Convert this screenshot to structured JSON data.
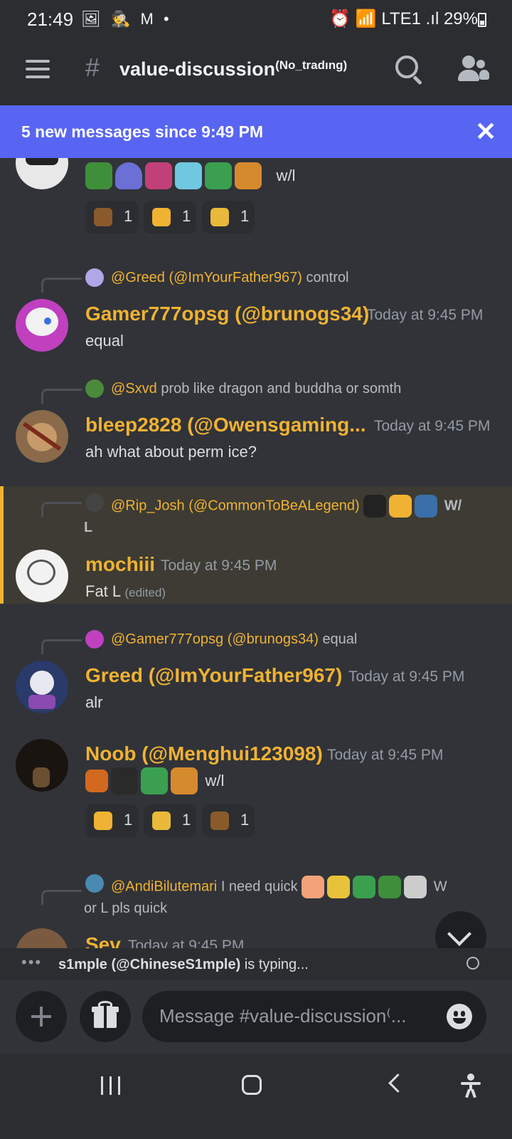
{
  "status_bar": {
    "time": "21:49",
    "left_icons": "🖼 🕵 M •",
    "right_text": "⏰ 📶 LTE1 .ıl 29%"
  },
  "header": {
    "channel_icon": "hash-lock-icon",
    "channel_name": "value-discussion",
    "channel_suffix": "(No_tradıng)"
  },
  "banner": {
    "text": "5 new messages since 9:49 PM",
    "close_icon": "close-icon"
  },
  "messages": [
    {
      "emoji_names": [
        "dragon-emoji",
        "blue-shell-emoji",
        "pink-creature-emoji",
        "tornado-emoji",
        "offer-want-emoji",
        "tiger-emoji"
      ],
      "emoji_colors": [
        "#3f8f3a",
        "#6b6fd6",
        "#c2407a",
        "#6fc8e0",
        "#3aa050",
        "#d68a2e"
      ],
      "text": "w/l",
      "reactions": [
        {
          "icon": "poop-icon",
          "color": "#8a5a2b",
          "count": "1"
        },
        {
          "icon": "trophy-icon",
          "color": "#f0b232",
          "count": "1"
        },
        {
          "icon": "equal-handshake-icon",
          "color": "#e8b93a",
          "count": "1"
        }
      ]
    },
    {
      "reply": {
        "name": "@Greed (@ImYourFather967)",
        "text": "control"
      },
      "username": "Gamer777opsg (@brunogs34)",
      "timestamp": "Today at 9:45 PM",
      "text": "equal"
    },
    {
      "reply": {
        "name": "@Sxvd",
        "text": "prob like dragon and buddha or somth"
      },
      "username": "bleep2828 (@Owensgaming...",
      "timestamp": "Today at 9:45 PM",
      "text": "ah what about perm ice?"
    },
    {
      "reply": {
        "name": "@Rip_Josh (@CommonToBeALegend)",
        "text_after_emoji": "W/",
        "text_line2": "L",
        "emoji_names": [
          "dark-figure-emoji",
          "pointing-hand-emoji",
          "portal-emoji"
        ],
        "emoji_colors": [
          "#222222",
          "#f0b232",
          "#3b6fa8"
        ]
      },
      "username": "mochiii",
      "timestamp": "Today at 9:45 PM",
      "text": "Fat L",
      "edited": "(edited)"
    },
    {
      "reply": {
        "name": "@Gamer777opsg (@brunogs34)",
        "text": "equal"
      },
      "username": "Greed (@ImYourFather967)",
      "timestamp": "Today at 9:45 PM",
      "text": "alr"
    },
    {
      "username": "Noob (@Menghui123098)",
      "timestamp": "Today at 9:45 PM",
      "emoji_names": [
        "fruit-emoji",
        "dark-figure-emoji",
        "offer-want-emoji",
        "tiger-emoji"
      ],
      "emoji_colors": [
        "#d2691e",
        "#2a2a2a",
        "#3aa050",
        "#d68a2e"
      ],
      "text": "w/l",
      "reactions": [
        {
          "icon": "trophy-icon",
          "color": "#f0b232",
          "count": "1"
        },
        {
          "icon": "equal-handshake-icon",
          "color": "#e8b93a",
          "count": "1"
        },
        {
          "icon": "poop-icon",
          "color": "#8a5a2b",
          "count": "1"
        }
      ]
    },
    {
      "reply": {
        "name": "@AndiBilutemari",
        "text": "I need quick",
        "text_after_emoji": "W",
        "text_line2": "or L pls quick",
        "emoji_names": [
          "comet-emoji",
          "buddha-emoji",
          "offer-want-emoji",
          "dragon-emoji",
          "spider-emoji"
        ],
        "emoji_colors": [
          "#f4a27a",
          "#e8c23a",
          "#3aa050",
          "#3f8f3a",
          "#cccccc"
        ]
      },
      "username": "Sev",
      "timestamp": "Today at 9:45 PM"
    }
  ],
  "typing": {
    "user": "s1mple (@ChineseS1mple)",
    "text": "is typing..."
  },
  "composer": {
    "placeholder": "Message #value-discussion⁽..."
  },
  "colors": {
    "accent": "#5865f2",
    "username": "#f0b232",
    "background": "#313338",
    "highlight": "#3d3b33"
  }
}
